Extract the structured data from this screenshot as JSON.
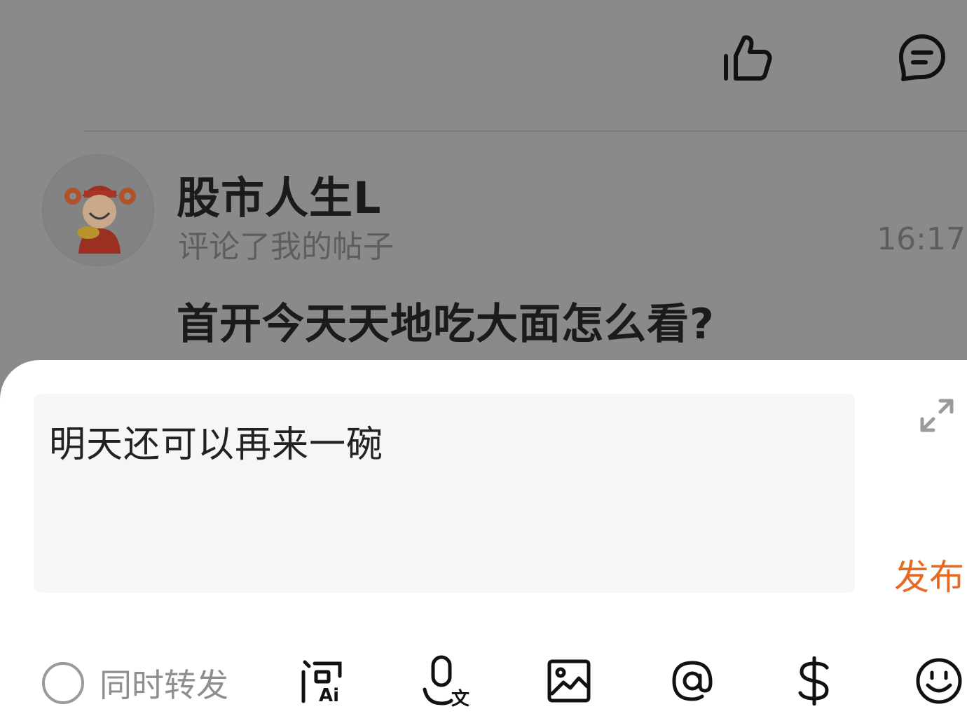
{
  "header": {
    "like_icon": "thumbs-up-icon",
    "comment_icon": "chat-bubble-icon"
  },
  "notification": {
    "username": "股市人生L",
    "action": "评论了我的帖子",
    "time": "16:17",
    "post_title": "首开今天天地吃大面怎么看?"
  },
  "reply": {
    "text": "明天还可以再来一碗",
    "publish_label": "发布",
    "expand_icon": "expand-icon",
    "repost_label": "同时转发",
    "repost_checked": false,
    "accent_color": "#e86a22"
  },
  "toolbar": {
    "icons": [
      "ai-question-icon",
      "voice-translate-icon",
      "image-icon",
      "at-icon",
      "dollar-icon",
      "emoji-icon"
    ]
  }
}
